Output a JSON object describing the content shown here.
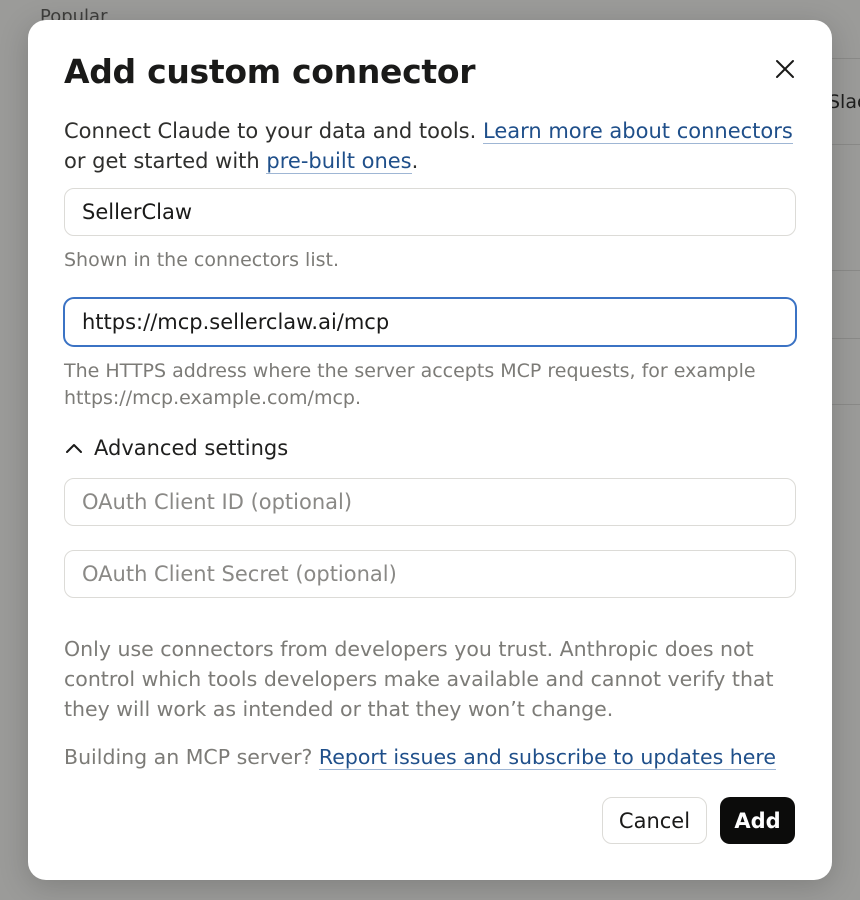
{
  "background": {
    "section_label": "Popular",
    "card_label": "Slac"
  },
  "modal": {
    "title": "Add custom connector",
    "intro": {
      "text_before": "Connect Claude to your data and tools. ",
      "link_learn_more": "Learn more about connectors",
      "text_middle": " or get started with ",
      "link_prebuilt": "pre-built ones",
      "text_after": "."
    },
    "name_field": {
      "value": "SellerClaw",
      "help": "Shown in the connectors list."
    },
    "url_field": {
      "value": "https://mcp.sellerclaw.ai/mcp",
      "help": "The HTTPS address where the server accepts MCP requests, for example https://mcp.example.com/mcp."
    },
    "advanced": {
      "label": "Advanced settings",
      "expanded": true,
      "client_id_placeholder": "OAuth Client ID (optional)",
      "client_secret_placeholder": "OAuth Client Secret (optional)"
    },
    "disclaimer": "Only use connectors from developers you trust. Anthropic does not control which tools developers make available and cannot verify that they will work as intended or that they won’t change.",
    "building": {
      "text": "Building an MCP server? ",
      "link": "Report issues and subscribe to updates here"
    },
    "buttons": {
      "cancel": "Cancel",
      "add": "Add"
    }
  },
  "colors": {
    "link": "#1f4f8a",
    "focus": "#3b73c4",
    "primary_button": "#0c0c0b",
    "overlay": "#9b9b99"
  }
}
